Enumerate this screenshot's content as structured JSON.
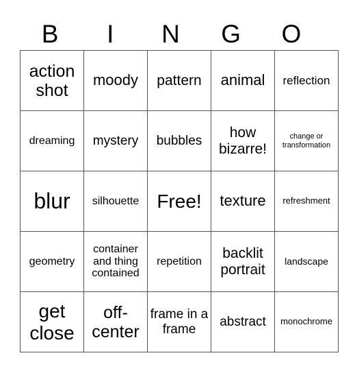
{
  "header": [
    "B",
    "I",
    "N",
    "G",
    "O"
  ],
  "rows": [
    [
      "action shot",
      "moody",
      "pattern",
      "animal",
      "reflection"
    ],
    [
      "dreaming",
      "mystery",
      "bubbles",
      "how bizarre!",
      "change or transformation"
    ],
    [
      "blur",
      "silhouette",
      "Free!",
      "texture",
      "refreshment"
    ],
    [
      "geometry",
      "container and thing contained",
      "repetition",
      "backlit portrait",
      "landscape"
    ],
    [
      "get close",
      "off-center",
      "frame in a frame",
      "abstract",
      "monochrome"
    ]
  ]
}
